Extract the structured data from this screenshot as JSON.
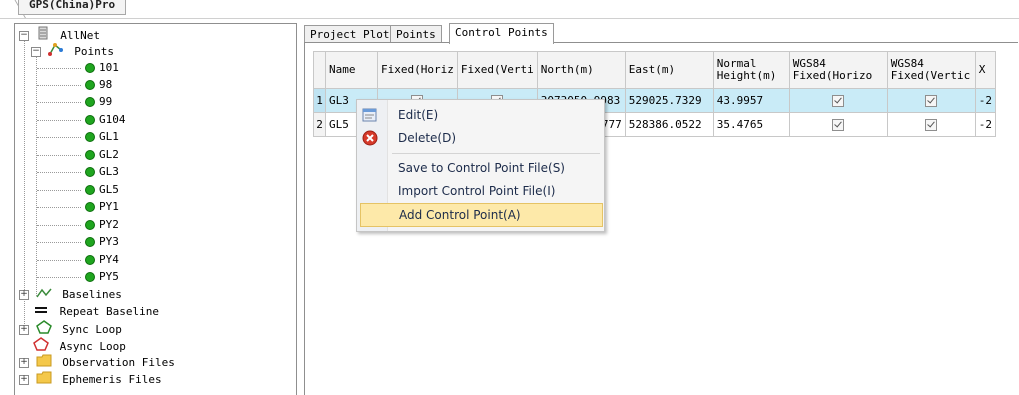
{
  "window": {
    "top_tab_label": "GPS(China)Pro"
  },
  "tree": {
    "root": "AllNet",
    "points_group": "Points",
    "points": [
      "101",
      "98",
      "99",
      "G104",
      "GL1",
      "GL2",
      "GL3",
      "GL5",
      "PY1",
      "PY2",
      "PY3",
      "PY4",
      "PY5"
    ],
    "groups": [
      "Baselines",
      "Repeat Baseline",
      "Sync Loop",
      "Async Loop",
      "Observation Files",
      "Ephemeris Files"
    ]
  },
  "tabs": [
    "Project Plot",
    "Points",
    "Control Points"
  ],
  "active_tab": "Control Points",
  "grid": {
    "columns": [
      "Name",
      "Fixed(Horiz",
      "Fixed(Verti",
      "North(m)",
      "East(m)",
      "Normal Height(m)",
      "WGS84 Fixed(Horizo",
      "WGS84 Fixed(Vertic",
      "X"
    ],
    "rows": [
      {
        "num": "1",
        "name": "GL3",
        "north": "3073050.9983",
        "east": "529025.7329",
        "height": "43.9957",
        "extra": "-2",
        "selected": true
      },
      {
        "num": "2",
        "name": "GL5",
        "north": ".4777",
        "east": "528386.0522",
        "height": "35.4765",
        "extra": "-2",
        "selected": false
      }
    ]
  },
  "context_menu": {
    "items": [
      "Edit(E)",
      "Delete(D)",
      "Save to Control Point File(S)",
      "Import Control Point File(I)",
      "Add Control Point(A)"
    ],
    "hovered": "Add Control Point(A)"
  },
  "colors": {
    "selection": "#c9ebf7",
    "menu_hover": "#fde9a9",
    "point_dot": "#1fa51f"
  }
}
